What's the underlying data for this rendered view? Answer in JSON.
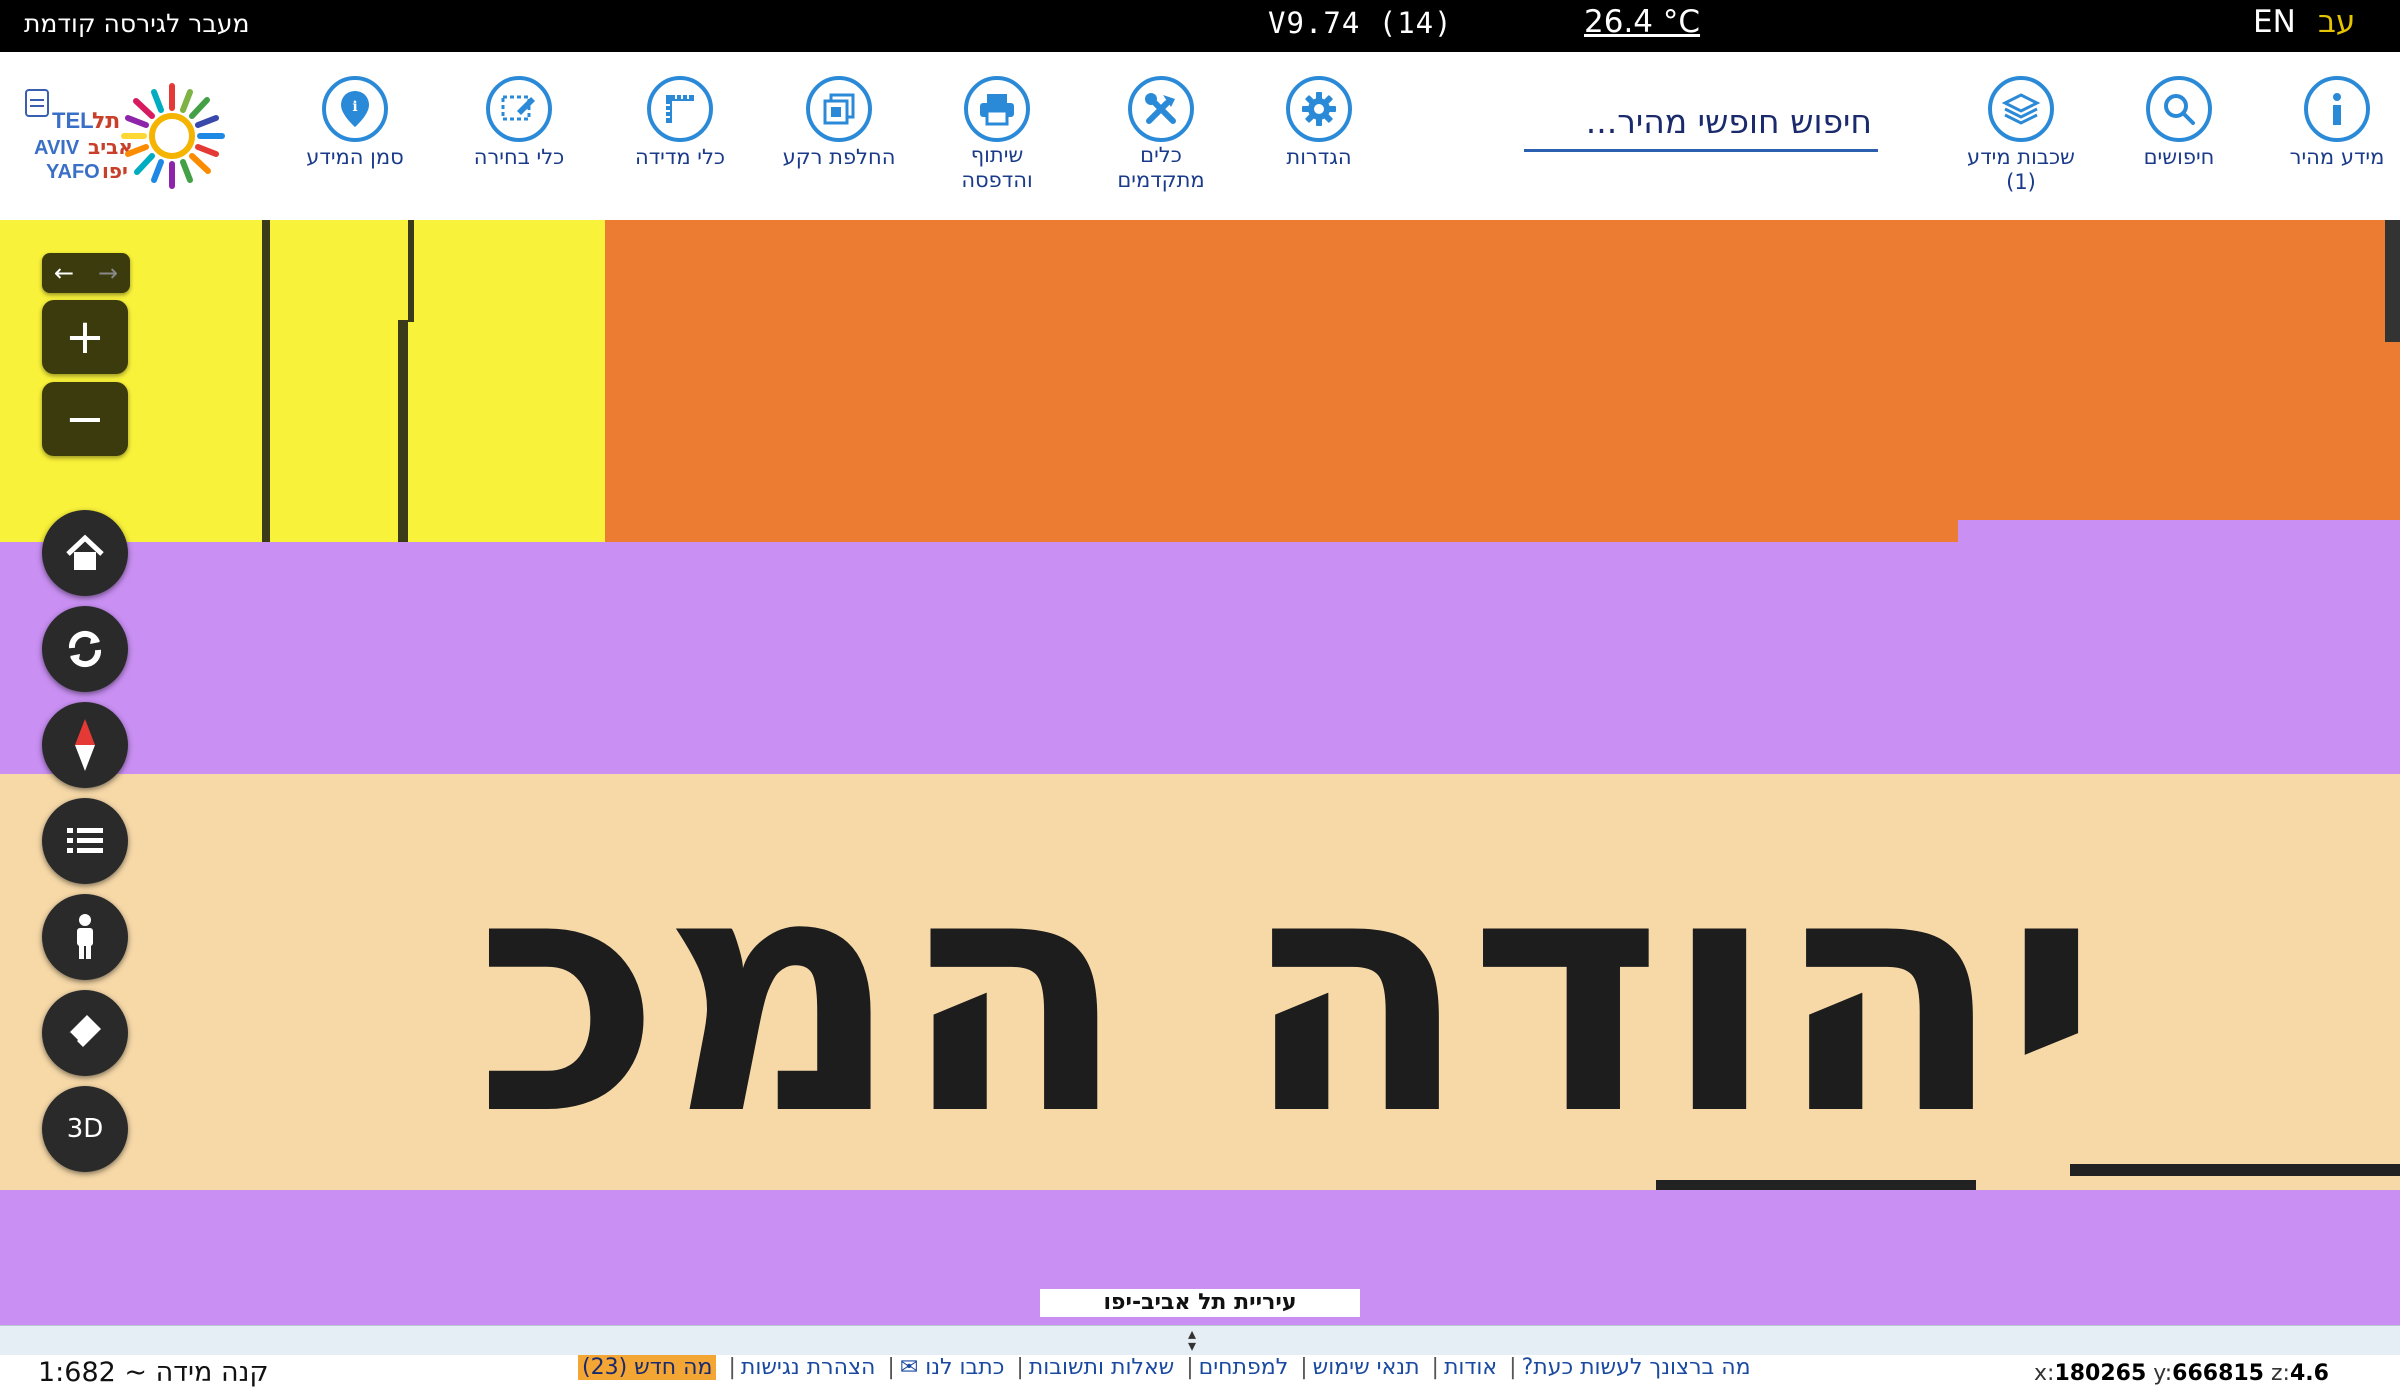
{
  "topbar": {
    "prev_version": "מעבר לגירסה קודמת",
    "version": "V9.74 (14)",
    "temperature": "26.4 °C",
    "lang_en": "EN",
    "lang_he": "עב"
  },
  "toolbar": {
    "tools_right": [
      {
        "id": "quick-info",
        "label": "מידע מהיר",
        "icon": "info-icon"
      },
      {
        "id": "searches",
        "label": "חיפושים",
        "icon": "search-icon"
      },
      {
        "id": "info-layers",
        "label": "שכבות מידע",
        "badge": "(1)",
        "icon": "layers-icon"
      }
    ],
    "search_placeholder": "חיפוש חופשי מהיר...",
    "tools_left": [
      {
        "id": "settings",
        "label": "הגדרות",
        "icon": "gear-icon"
      },
      {
        "id": "advanced-tools",
        "label": "כלים",
        "label2": "מתקדמים",
        "icon": "tools-icon"
      },
      {
        "id": "share-print",
        "label": "שיתוף",
        "label2": "והדפסה",
        "icon": "printer-icon"
      },
      {
        "id": "basemap",
        "label": "החלפת רקע",
        "icon": "basemap-icon"
      },
      {
        "id": "measure",
        "label": "כלי מדידה",
        "icon": "ruler-icon"
      },
      {
        "id": "select",
        "label": "כלי בחירה",
        "icon": "select-icon"
      },
      {
        "id": "marker",
        "label": "סמן המידע",
        "icon": "pin-icon"
      }
    ],
    "logo_alt": "TEL AVIV YAFO תל אביב יפו"
  },
  "map": {
    "street_label": "יהודה המכ",
    "attribution": "עיריית תל אביב-יפו",
    "colors": {
      "yellow": "#f9f23a",
      "orange": "#ec7c32",
      "purple": "#c98ff3",
      "beige": "#f7d9a8"
    },
    "controls": [
      "pan-arrows",
      "zoom-in",
      "zoom-out",
      "home",
      "refresh",
      "compass",
      "legend",
      "street-view",
      "eraser",
      "3d"
    ],
    "btn_3d": "3D"
  },
  "footer": {
    "scale": "קנה מידה ~ 1:682",
    "links": [
      "מה ברצונך לעשות כעת?",
      "אודות",
      "תנאי שימוש",
      "למפתחים",
      "שאלות ותשובות",
      "כתבו לנו ✉",
      "הצהרת נגישות"
    ],
    "whats_new": "מה חדש (23)",
    "coords": {
      "x_label": "x:",
      "x": "180265",
      "y_label": "y:",
      "y": "666815",
      "z_label": "z:",
      "z": "4.6"
    }
  }
}
